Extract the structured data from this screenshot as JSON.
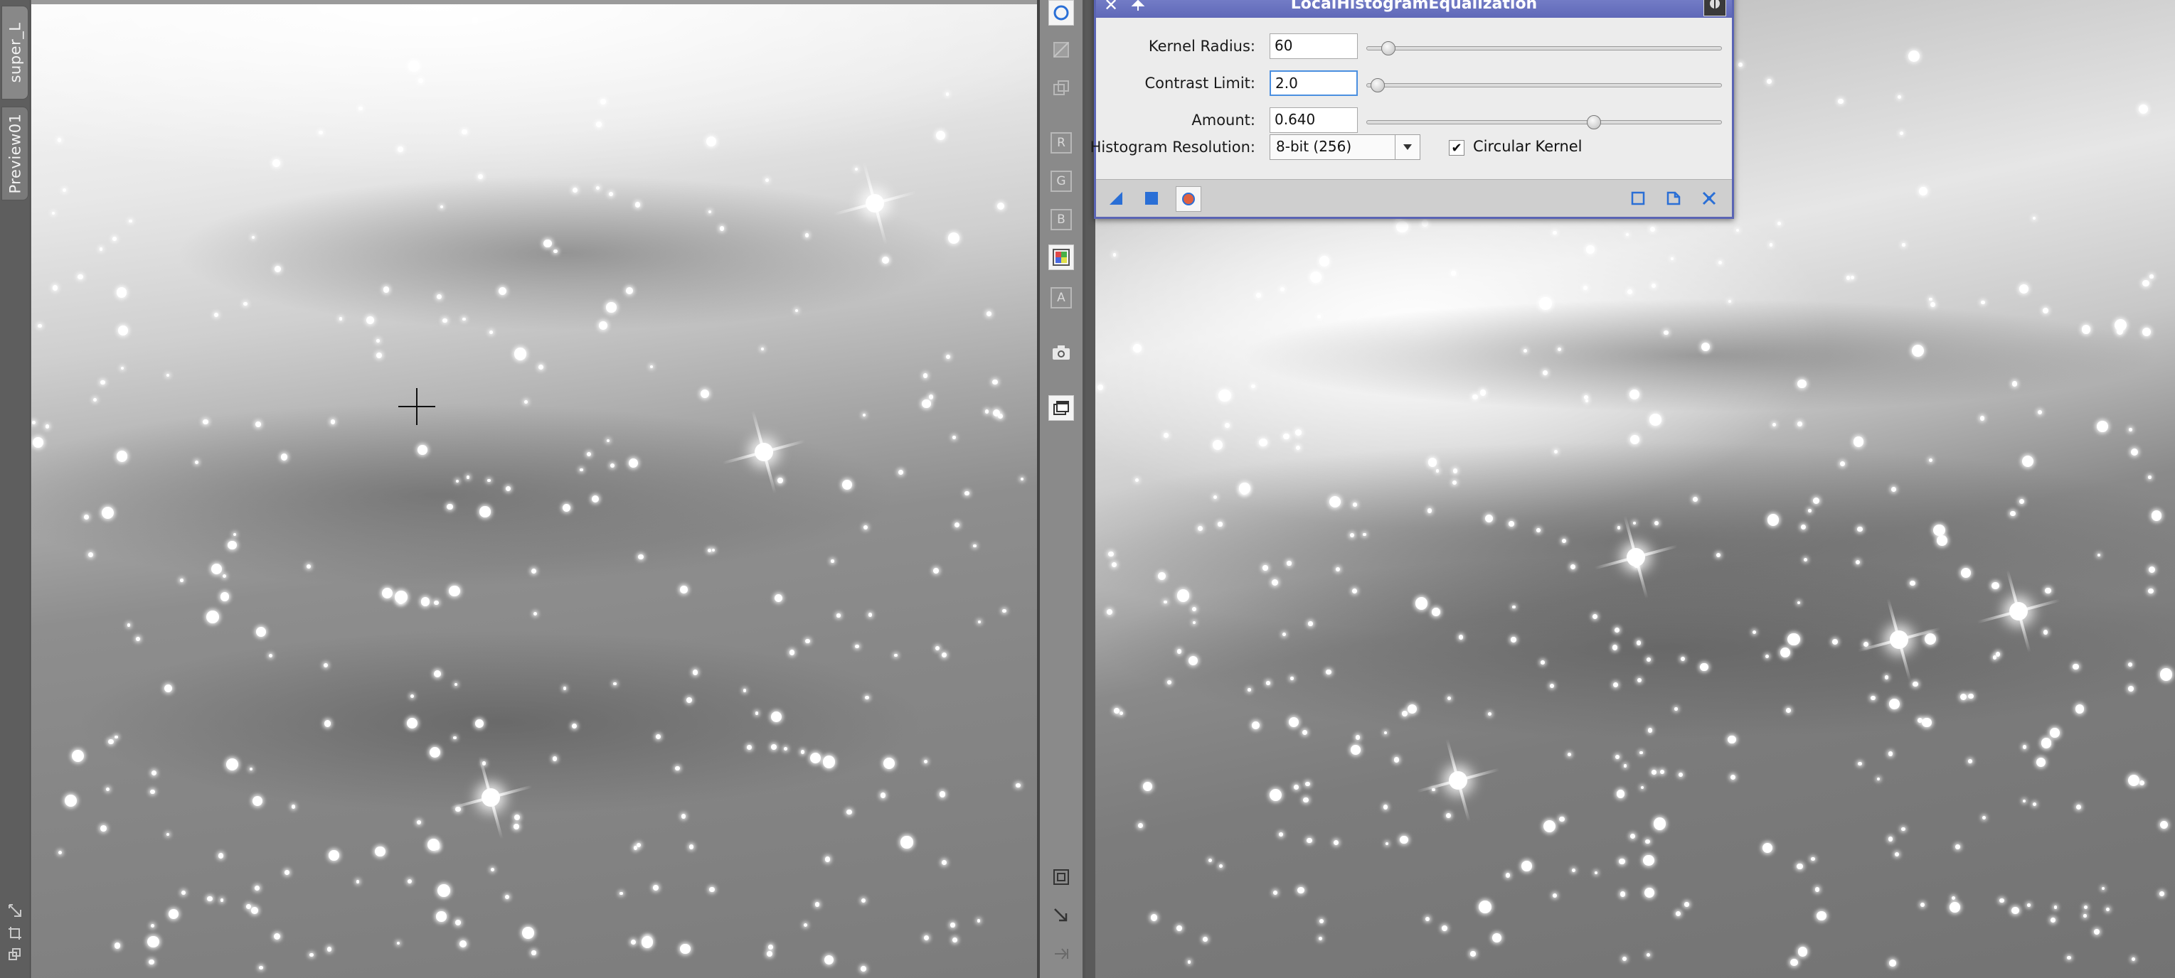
{
  "left_tabs": [
    {
      "label": "super_L"
    },
    {
      "label": "Preview01"
    }
  ],
  "left_strip_icons": [
    "zoom-fit-icon",
    "crop-icon",
    "clone-icon"
  ],
  "mid_toolbar": {
    "letters": [
      "R",
      "G",
      "B",
      "A"
    ]
  },
  "dialog": {
    "title": "LocalHistogramEqualization",
    "fields": [
      {
        "label": "Kernel Radius:",
        "value": "60",
        "slider_fraction": 0.06
      },
      {
        "label": "Contrast Limit:",
        "value": "2.0",
        "slider_fraction": 0.03
      },
      {
        "label": "Amount:",
        "value": "0.640",
        "slider_fraction": 0.64
      }
    ],
    "histogram_label": "Histogram Resolution:",
    "histogram_value": "8-bit (256)",
    "circular_kernel_label": "Circular Kernel",
    "circular_kernel_checked": true
  },
  "colors": {
    "dialog_title_bar": "#6a72c0",
    "accent_blue": "#2a6fd6",
    "preview_orange": "#e06040"
  }
}
